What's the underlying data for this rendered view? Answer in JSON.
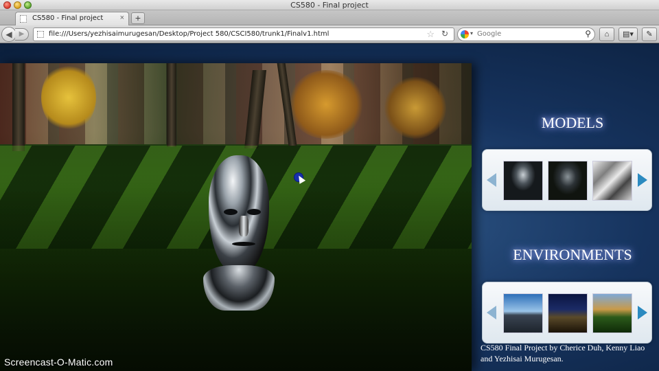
{
  "window": {
    "title": "CS580 - Final project"
  },
  "tab": {
    "label": "CS580 - Final project",
    "close": "×",
    "new_tab": "+"
  },
  "nav": {
    "url": "file:///Users/yezhisaimurugesan/Desktop/Project 580/CSCI580/trunk1/Finalv1.html",
    "search_placeholder": "Google"
  },
  "page": {
    "models_title": "MODELS",
    "environments_title": "ENVIRONMENTS",
    "credits": "CS580 Final Project by Cherice Duh, Kenny Liao and Yezhisai Murugesan."
  },
  "watermark": "Screencast-O-Matic.com",
  "icons": {
    "back": "◀",
    "forward": "▶",
    "star": "☆",
    "reload": "↻",
    "magnifier": "⚲",
    "home": "⌂",
    "bookmarks": "▤▾",
    "addon": "✎"
  },
  "colors": {
    "page_bg": "#16335e",
    "title_glow": "#a8b8ff",
    "carousel_arrow": "#2b8ac0"
  }
}
